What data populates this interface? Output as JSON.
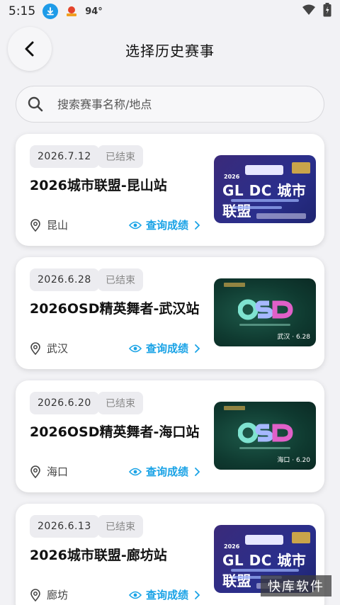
{
  "status_bar": {
    "time": "5:15",
    "temperature": "94°",
    "icons": [
      "download-icon",
      "app-notification-icon",
      "wifi-icon",
      "battery-icon"
    ]
  },
  "header": {
    "title": "选择历史赛事",
    "back_icon": "chevron-left-icon"
  },
  "search": {
    "placeholder": "搜索赛事名称/地点",
    "value": ""
  },
  "events": [
    {
      "date": "2026.7.12",
      "status": "已结束",
      "title": "2026城市联盟-昆山站",
      "location": "昆山",
      "link_label": "查询成绩",
      "thumb": {
        "type": "gldc",
        "heading": "GL DC 城市联盟",
        "year": "2026"
      }
    },
    {
      "date": "2026.6.28",
      "status": "已结束",
      "title": "2026OSD精英舞者-武汉站",
      "location": "武汉",
      "link_label": "查询成绩",
      "thumb": {
        "type": "osd",
        "city": "武汉 · 6.28"
      }
    },
    {
      "date": "2026.6.20",
      "status": "已结束",
      "title": "2026OSD精英舞者-海口站",
      "location": "海口",
      "link_label": "查询成绩",
      "thumb": {
        "type": "osd",
        "city": "海口 · 6.20"
      }
    },
    {
      "date": "2026.6.13",
      "status": "已结束",
      "title": "2026城市联盟-廊坊站",
      "location": "廊坊",
      "link_label": "查询成绩",
      "thumb": {
        "type": "gldc",
        "heading": "GL DC 城市联盟",
        "year": "2026"
      }
    }
  ],
  "watermark": "快库软件",
  "colors": {
    "accent": "#1aa3e6",
    "background": "#f2f2f5",
    "tag_bg": "#ececf0"
  }
}
